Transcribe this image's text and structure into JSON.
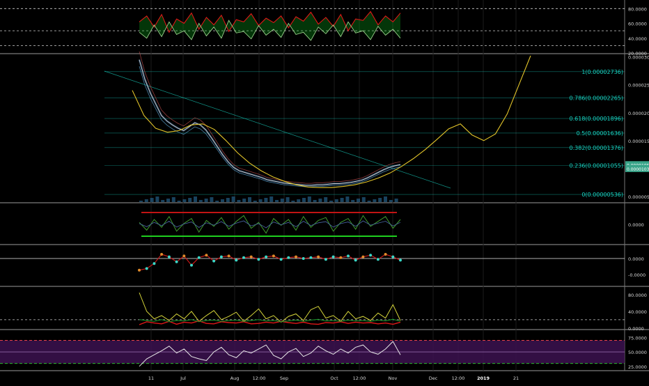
{
  "colors": {
    "background": "#000000",
    "fib": "#18d6c4",
    "price": "#c9c9c9",
    "cup": "#e3c52a",
    "stoch_red": "#e01717",
    "stoch_green": "#0c9a1b",
    "oscillator_line": "#3f9a2e",
    "macd_teal": "#39d8c8",
    "rsi_line": "#e8e8e8",
    "rsi_band": "#3c1250",
    "rsi_upper": "#ff4a4a",
    "rsi_lower": "#2bd12b"
  },
  "chart_data": [
    {
      "type": "line",
      "pane": "top-indicator",
      "ylim": [
        20,
        85
      ],
      "yticks": [
        "80.0000",
        "60.0000",
        "40.0000",
        "20.0000"
      ],
      "levels": [
        80,
        50,
        30
      ],
      "series": [
        {
          "values": [
            62,
            70,
            55,
            72,
            48,
            66,
            60,
            74,
            52,
            68,
            58,
            71,
            49,
            65,
            62,
            73,
            57,
            67,
            61,
            70,
            54,
            69,
            63,
            75,
            59,
            68,
            56,
            72,
            50,
            66,
            64,
            76,
            58,
            70,
            62,
            74
          ]
        },
        {
          "values": [
            48,
            40,
            58,
            42,
            62,
            45,
            50,
            38,
            60,
            43,
            55,
            40,
            64,
            47,
            49,
            39,
            57,
            44,
            52,
            41,
            60,
            45,
            48,
            37,
            55,
            46,
            58,
            42,
            62,
            47,
            50,
            38,
            56,
            44,
            52,
            40
          ]
        }
      ]
    },
    {
      "type": "line",
      "pane": "price",
      "ylim": [
        4e-06,
        3.02e-05
      ],
      "yticks": [
        "0.00003000",
        "0.00002500",
        "0.00002000",
        "0.00001500",
        "0.00001000",
        "0.00000500"
      ],
      "last_price_labels": [
        "0.00001055",
        "0.00001030"
      ],
      "fib_levels": [
        {
          "label": "1(0.00002736)",
          "value": 2.736e-05
        },
        {
          "label": "0.786(0.00002265)",
          "value": 2.265e-05
        },
        {
          "label": "0.618(0.00001896)",
          "value": 1.896e-05
        },
        {
          "label": "0.5(0.00001636)",
          "value": 1.636e-05
        },
        {
          "label": "0.382(0.00001376)",
          "value": 1.376e-05
        },
        {
          "label": "0.236(0.00001055)",
          "value": 1.055e-05
        },
        {
          "label": "0(0.00000536)",
          "value": 5.36e-06
        }
      ],
      "price_series": [
        2.95e-05,
        2.6e-05,
        2.35e-05,
        2.15e-05,
        1.95e-05,
        1.85e-05,
        1.78e-05,
        1.72e-05,
        1.68e-05,
        1.75e-05,
        1.82e-05,
        1.78e-05,
        1.69e-05,
        1.55e-05,
        1.4e-05,
        1.25e-05,
        1.12e-05,
        1.02e-05,
        9.6e-06,
        9.3e-06,
        9e-06,
        8.7e-06,
        8.4e-06,
        8e-06,
        7.8e-06,
        7.6e-06,
        7.4e-06,
        7.3e-06,
        7.2e-06,
        7.1e-06,
        7e-06,
        7e-06,
        7.1e-06,
        7.1e-06,
        7.2e-06,
        7.3e-06,
        7.3e-06,
        7.4e-06,
        7.5e-06,
        7.7e-06,
        7.9e-06,
        8.3e-06,
        8.8e-06,
        9.3e-06,
        9.8e-06,
        1.02e-05,
        1.05e-05,
        1.07e-05
      ],
      "cup_curve": [
        2.4e-05,
        1.95e-05,
        1.72e-05,
        1.65e-05,
        1.68e-05,
        1.78e-05,
        1.8e-05,
        1.7e-05,
        1.5e-05,
        1.28e-05,
        1.1e-05,
        9.6e-06,
        8.5e-06,
        7.7e-06,
        7.1e-06,
        6.7e-06,
        6.6e-06,
        6.6e-06,
        6.8e-06,
        7.1e-06,
        7.6e-06,
        8.3e-06,
        9.2e-06,
        1.04e-05,
        1.18e-05,
        1.34e-05,
        1.52e-05,
        1.71e-05,
        1.8e-05,
        1.6e-05,
        1.5e-05,
        1.62e-05,
        1.98e-05,
        2.5e-05,
        3.02e-05
      ]
    },
    {
      "type": "line",
      "pane": "oscillator",
      "yticks": [
        "0.0000"
      ],
      "series": [
        {
          "values": [
            0.2,
            -0.6,
            0.5,
            -0.3,
            0.8,
            -0.7,
            0.1,
            0.6,
            -0.8,
            0.4,
            -0.2,
            0.7,
            -0.5,
            0.3,
            0.9,
            -0.4,
            0.2,
            -0.9,
            0.6,
            -0.1,
            0.5,
            -0.6,
            0.8,
            -0.3,
            0.4,
            0.7,
            -0.7,
            0.2,
            0.6,
            -0.5,
            0.9,
            -0.2,
            0.3,
            0.8,
            -0.4,
            0.5
          ]
        }
      ]
    },
    {
      "type": "scatter",
      "pane": "macd",
      "yticks": [
        "0.0000",
        "-0.0000"
      ],
      "values": [
        -1.4,
        -1.2,
        -0.6,
        0.5,
        0.2,
        -0.4,
        0.3,
        -0.8,
        0.1,
        0.4,
        -0.3,
        0.2,
        0.3,
        -0.2,
        0.1,
        0.2,
        -0.1,
        0.2,
        0.3,
        -0.1,
        0.1,
        0.2,
        0.0,
        0.1,
        0.2,
        -0.1,
        0.2,
        0.1,
        0.3,
        -0.2,
        0.2,
        0.4,
        -0.1,
        0.5,
        0.2,
        -0.2
      ]
    },
    {
      "type": "line",
      "pane": "dmi",
      "ylim": [
        -2,
        95
      ],
      "yticks": [
        "80.0000",
        "40.0000",
        "0.0000"
      ],
      "series": [
        {
          "values": [
            85,
            40,
            22,
            30,
            18,
            34,
            22,
            40,
            16,
            30,
            42,
            20,
            28,
            38,
            16,
            30,
            46,
            22,
            30,
            14,
            28,
            34,
            18,
            44,
            52,
            24,
            30,
            16,
            40,
            22,
            28,
            18,
            36,
            24,
            56,
            18
          ]
        },
        {
          "values": [
            8,
            15,
            12,
            10,
            16,
            9,
            14,
            12,
            17,
            11,
            10,
            15,
            13,
            12,
            15,
            10,
            11,
            14,
            12,
            16,
            13,
            11,
            14,
            10,
            9,
            13,
            12,
            15,
            11,
            14,
            12,
            13,
            10,
            12,
            9,
            14
          ]
        },
        {
          "values": [
            20,
            18,
            16,
            20,
            15,
            18,
            17,
            20,
            15,
            18,
            19,
            16,
            18,
            19,
            16,
            18,
            20,
            17,
            18,
            15,
            17,
            19,
            16,
            19,
            21,
            17,
            18,
            16,
            19,
            17,
            18,
            16,
            19,
            17,
            21,
            16
          ]
        }
      ]
    },
    {
      "type": "line",
      "pane": "rsi",
      "ylim": [
        20,
        85
      ],
      "yticks": [
        "75.0000",
        "50.0000",
        "25.0000"
      ],
      "levels": [
        70,
        50,
        30
      ],
      "series": [
        {
          "values": [
            25,
            38,
            45,
            52,
            60,
            48,
            55,
            42,
            38,
            35,
            50,
            58,
            45,
            40,
            52,
            48,
            55,
            62,
            44,
            38,
            50,
            56,
            42,
            48,
            60,
            52,
            46,
            55,
            48,
            58,
            62,
            50,
            46,
            55,
            68,
            45
          ]
        }
      ]
    }
  ],
  "x_axis": {
    "labels": [
      "11",
      "Jul",
      "Aug",
      "12:00",
      "Sep",
      "Oct",
      "12:00",
      "Nov",
      "Dec",
      "12:00",
      "2019",
      "21"
    ]
  }
}
